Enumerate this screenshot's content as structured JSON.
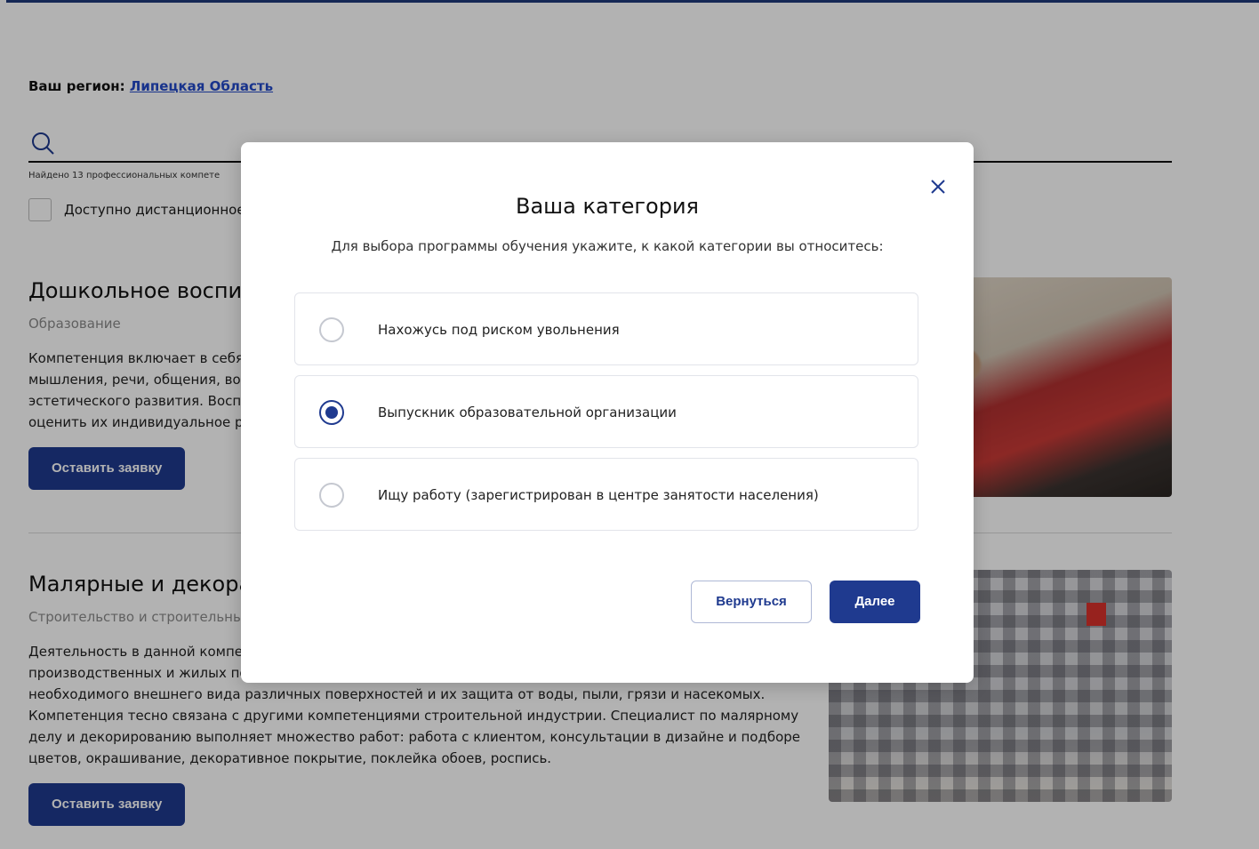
{
  "region": {
    "label": "Ваш регион:",
    "value": "Липецкая Область"
  },
  "search": {
    "found_text": "Найдено 13 профессиональных компете"
  },
  "filter": {
    "remote_label": "Доступно дистанционное"
  },
  "cards": [
    {
      "title": "Дошкольное воспит",
      "category": "Образование",
      "description": [
        "Компетенция включает в себя",
        "мышления, речи, общения, во",
        "эстетического развития. Восп",
        "оценить их индивидуальное ра"
      ],
      "button": "Оставить заявку"
    },
    {
      "title": "Малярные и декорат",
      "category": "Строительство и строительны",
      "description": [
        "Деятельность в данной компе",
        "производственных и жилых по",
        "необходимого внешнего вида различных поверхностей и их защита от воды, пыли, грязи и насекомых.",
        "Компетенция тесно связана с другими компетенциями строительной индустрии. Специалист по малярному",
        "делу и декорированию выполняет множество работ: работа с клиентом, консультации в дизайне и подборе",
        "цветов, окрашивание, декоративное покрытие, поклейка обоев, роспись."
      ],
      "button": "Оставить заявку"
    }
  ],
  "modal": {
    "title": "Ваша категория",
    "subtitle": "Для выбора программы обучения укажите, к какой категории вы относитесь:",
    "options": [
      {
        "label": "Нахожусь под риском увольнения",
        "selected": false
      },
      {
        "label": "Выпускник образовательной организации",
        "selected": true
      },
      {
        "label": "Ищу работу (зарегистрирован в центре занятости населения)",
        "selected": false
      }
    ],
    "back_button": "Вернуться",
    "next_button": "Далее"
  },
  "colors": {
    "accent": "#1f3a8f",
    "link": "#2349c9",
    "overlay": "rgba(0,0,0,0.30)"
  }
}
